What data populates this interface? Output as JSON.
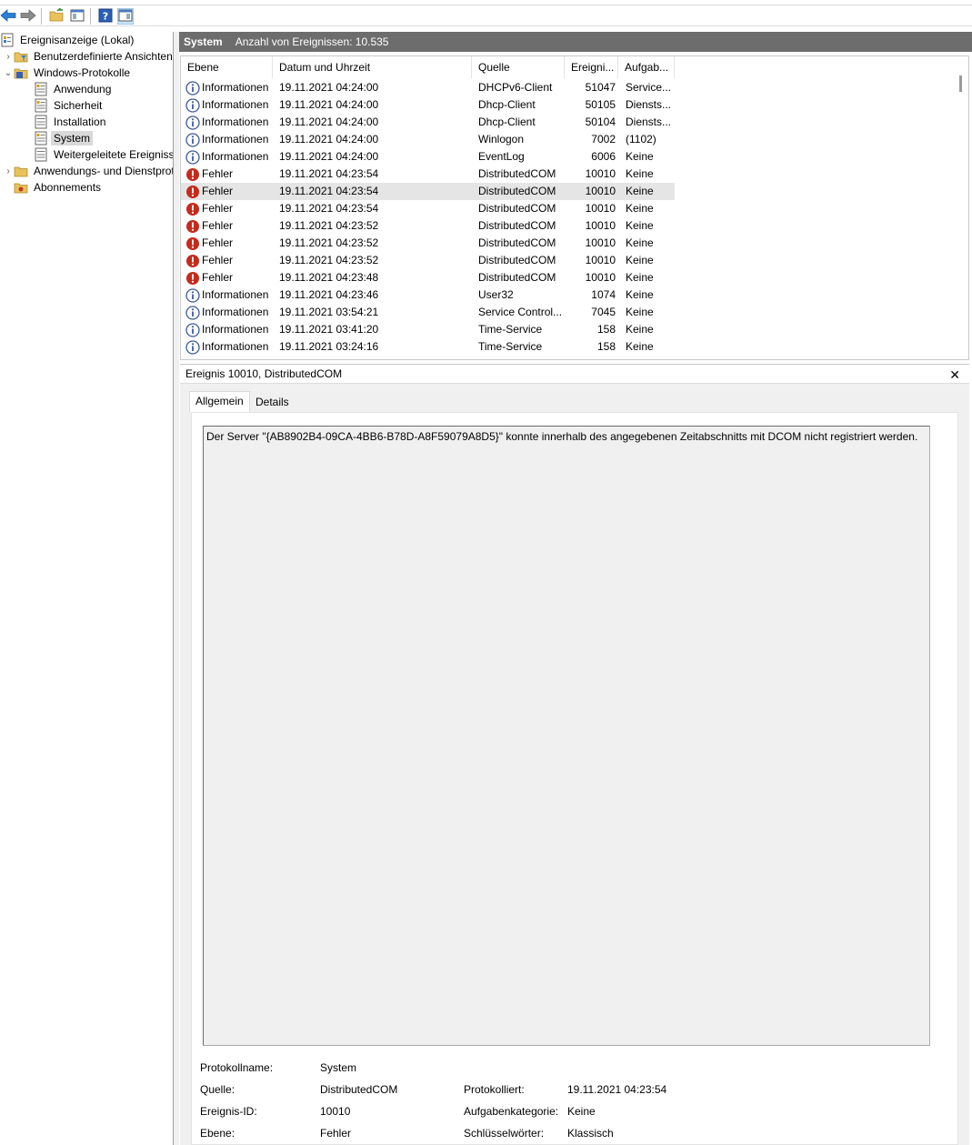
{
  "toolbar": {
    "buttons": [
      {
        "name": "back-button",
        "icon": "arrow-left-icon"
      },
      {
        "name": "forward-button",
        "icon": "arrow-right-icon"
      },
      {
        "name": "up-folder-button",
        "icon": "folder-up-icon"
      },
      {
        "name": "show-hide-console-tree-button",
        "icon": "console-tree-icon"
      },
      {
        "name": "help-button",
        "icon": "help-icon"
      },
      {
        "name": "show-hide-action-pane-button",
        "icon": "action-pane-icon"
      }
    ]
  },
  "tree": {
    "items": [
      {
        "label": "Ereignisanzeige (Lokal)",
        "icon": "event-viewer-icon"
      },
      {
        "label": "Benutzerdefinierte Ansichten",
        "icon": "folder-filter-icon"
      },
      {
        "label": "Windows-Protokolle",
        "icon": "folder-logs-icon"
      },
      {
        "label": "Anwendung",
        "icon": "log-icon"
      },
      {
        "label": "Sicherheit",
        "icon": "log-icon"
      },
      {
        "label": "Installation",
        "icon": "log-icon"
      },
      {
        "label": "System",
        "icon": "log-icon"
      },
      {
        "label": "Weitergeleitete Ereignisse",
        "icon": "log-icon"
      },
      {
        "label": "Anwendungs- und Dienstprotokolle",
        "icon": "folder-icon"
      },
      {
        "label": "Abonnements",
        "icon": "subscriptions-icon"
      }
    ]
  },
  "header": {
    "log_name": "System",
    "count_text": "Anzahl von Ereignissen: 10.535"
  },
  "list": {
    "columns": [
      "Ebene",
      "Datum und Uhrzeit",
      "Quelle",
      "Ereigni...",
      "Aufgab..."
    ],
    "rows": [
      {
        "level": "Informationen",
        "type": "info",
        "datetime": "19.11.2021 04:24:00",
        "source": "DHCPv6-Client",
        "id": "51047",
        "task": "Service..."
      },
      {
        "level": "Informationen",
        "type": "info",
        "datetime": "19.11.2021 04:24:00",
        "source": "Dhcp-Client",
        "id": "50105",
        "task": "Diensts..."
      },
      {
        "level": "Informationen",
        "type": "info",
        "datetime": "19.11.2021 04:24:00",
        "source": "Dhcp-Client",
        "id": "50104",
        "task": "Diensts..."
      },
      {
        "level": "Informationen",
        "type": "info",
        "datetime": "19.11.2021 04:24:00",
        "source": "Winlogon",
        "id": "7002",
        "task": "(1102)"
      },
      {
        "level": "Informationen",
        "type": "info",
        "datetime": "19.11.2021 04:24:00",
        "source": "EventLog",
        "id": "6006",
        "task": "Keine"
      },
      {
        "level": "Fehler",
        "type": "error",
        "datetime": "19.11.2021 04:23:54",
        "source": "DistributedCOM",
        "id": "10010",
        "task": "Keine"
      },
      {
        "level": "Fehler",
        "type": "error",
        "datetime": "19.11.2021 04:23:54",
        "source": "DistributedCOM",
        "id": "10010",
        "task": "Keine",
        "selected": true
      },
      {
        "level": "Fehler",
        "type": "error",
        "datetime": "19.11.2021 04:23:54",
        "source": "DistributedCOM",
        "id": "10010",
        "task": "Keine"
      },
      {
        "level": "Fehler",
        "type": "error",
        "datetime": "19.11.2021 04:23:52",
        "source": "DistributedCOM",
        "id": "10010",
        "task": "Keine"
      },
      {
        "level": "Fehler",
        "type": "error",
        "datetime": "19.11.2021 04:23:52",
        "source": "DistributedCOM",
        "id": "10010",
        "task": "Keine"
      },
      {
        "level": "Fehler",
        "type": "error",
        "datetime": "19.11.2021 04:23:52",
        "source": "DistributedCOM",
        "id": "10010",
        "task": "Keine"
      },
      {
        "level": "Fehler",
        "type": "error",
        "datetime": "19.11.2021 04:23:48",
        "source": "DistributedCOM",
        "id": "10010",
        "task": "Keine"
      },
      {
        "level": "Informationen",
        "type": "info",
        "datetime": "19.11.2021 04:23:46",
        "source": "User32",
        "id": "1074",
        "task": "Keine"
      },
      {
        "level": "Informationen",
        "type": "info",
        "datetime": "19.11.2021 03:54:21",
        "source": "Service Control...",
        "id": "7045",
        "task": "Keine"
      },
      {
        "level": "Informationen",
        "type": "info",
        "datetime": "19.11.2021 03:41:20",
        "source": "Time-Service",
        "id": "158",
        "task": "Keine"
      },
      {
        "level": "Informationen",
        "type": "info",
        "datetime": "19.11.2021 03:24:16",
        "source": "Time-Service",
        "id": "158",
        "task": "Keine"
      }
    ]
  },
  "details": {
    "title": "Ereignis 10010, DistributedCOM",
    "tabs": [
      "Allgemein",
      "Details"
    ],
    "message": "Der Server \"{AB8902B4-09CA-4BB6-B78D-A8F59079A8D5}\" konnte innerhalb des angegebenen Zeitabschnitts mit DCOM nicht registriert werden.",
    "props": {
      "protokollname_label": "Protokollname:",
      "protokollname": "System",
      "quelle_label": "Quelle:",
      "quelle": "DistributedCOM",
      "protokolliert_label": "Protokolliert:",
      "protokolliert": "19.11.2021 04:23:54",
      "ereignis_id_label": "Ereignis-ID:",
      "ereignis_id": "10010",
      "aufgabenkategorie_label": "Aufgabenkategorie:",
      "aufgabenkategorie": "Keine",
      "ebene_label": "Ebene:",
      "ebene": "Fehler",
      "schluesselwoerter_label": "Schlüsselwörter:",
      "schluesselwoerter": "Klassisch"
    }
  },
  "colors": {
    "header_bg": "#6d6d6d",
    "info_icon": "#3c5a99",
    "error_icon": "#c42b1c",
    "selected_row": "#e5e5e5"
  }
}
